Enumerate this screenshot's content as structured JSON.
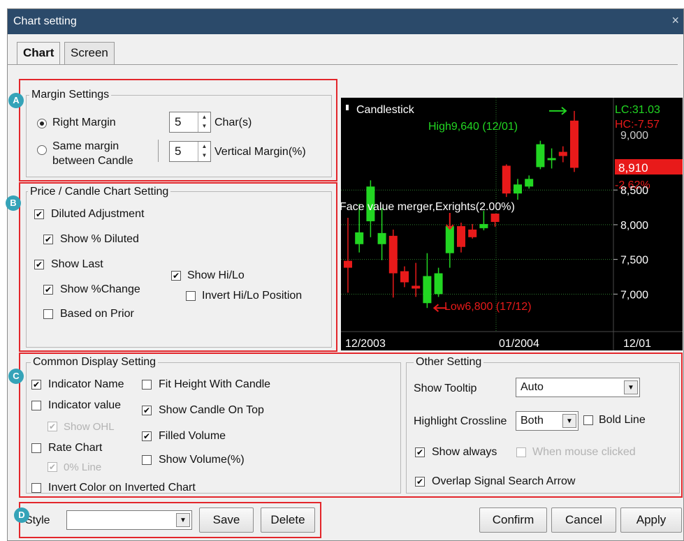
{
  "window": {
    "title": "Chart setting",
    "close_symbol": "×"
  },
  "tabs": [
    {
      "label": "Chart"
    },
    {
      "label": "Screen"
    }
  ],
  "badges": [
    "A",
    "B",
    "C",
    "D"
  ],
  "margin": {
    "title": "Margin Settings",
    "right_margin_label": "Right Margin",
    "right_margin_value": "5",
    "right_margin_unit": "Char(s)",
    "same_margin_label_1": "Same margin",
    "same_margin_label_2": "between Candle",
    "same_margin_value": "5",
    "vertical_margin_label": "Vertical Margin(%)",
    "selected": "right"
  },
  "price": {
    "title": "Price / Candle Chart Setting",
    "diluted_adjustment": "Diluted Adjustment",
    "show_pct_diluted": "Show % Diluted",
    "show_last": "Show Last",
    "show_pct_change": "Show %Change",
    "based_on_prior": "Based on Prior",
    "show_hilo": "Show Hi/Lo",
    "invert_hilo": "Invert Hi/Lo Position"
  },
  "common": {
    "title": "Common Display Setting",
    "indicator_name": "Indicator Name",
    "indicator_value": "Indicator value",
    "show_ohl": "Show OHL",
    "rate_chart": "Rate Chart",
    "zero_line": "0% Line",
    "invert_color": "Invert Color on Inverted Chart",
    "fit_height": "Fit Height With Candle",
    "show_candle_top": "Show Candle On Top",
    "filled_volume": "Filled Volume",
    "show_volume_pct": "Show Volume(%)"
  },
  "other": {
    "title": "Other Setting",
    "show_tooltip_label": "Show Tooltip",
    "show_tooltip_value": "Auto",
    "highlight_label": "Highlight Crossline",
    "highlight_value": "Both",
    "bold_line": "Bold Line",
    "show_always": "Show always",
    "when_clicked": "When mouse clicked",
    "overlap_signal": "Overlap Signal Search Arrow"
  },
  "footer": {
    "style_label": "Style",
    "style_value": "",
    "save": "Save",
    "delete": "Delete",
    "confirm": "Confirm",
    "cancel": "Cancel",
    "apply": "Apply"
  },
  "colors": {
    "up": "#22d622",
    "down": "#e81a1a",
    "highlight": "#e3262b",
    "title_bar": "#2b4a6a"
  },
  "chart_data": {
    "type": "candlestick",
    "title": "Candlestick",
    "lc_label": "LC:31.03",
    "hc_label": "HC:-7.57",
    "high_label": "High9,640 (12/01)",
    "low_label": "Low6,800 (17/12)",
    "annotation": "Face value merger,Exrights(2.00%)",
    "last_price": "8,910",
    "last_change": "-2.62%",
    "top_tick_partial": "9,000",
    "y_ticks": [
      "8,500",
      "8,000",
      "7,500",
      "7,000"
    ],
    "y_tick_values": [
      8500,
      8000,
      7500,
      7000
    ],
    "ylim": [
      6460,
      9830
    ],
    "x_labels": [
      "12/2003",
      "01/2004",
      "12/01"
    ],
    "candles": [
      {
        "o": 7480,
        "c": 7380,
        "h": 8100,
        "l": 7020
      },
      {
        "o": 7720,
        "c": 7890,
        "h": 8300,
        "l": 7600
      },
      {
        "o": 8050,
        "c": 8550,
        "h": 8640,
        "l": 7820
      },
      {
        "o": 7720,
        "c": 7880,
        "h": 8240,
        "l": 7490
      },
      {
        "o": 7840,
        "c": 7300,
        "h": 7930,
        "l": 6950
      },
      {
        "o": 7330,
        "c": 7170,
        "h": 7400,
        "l": 7100
      },
      {
        "o": 7120,
        "c": 7080,
        "h": 7450,
        "l": 6960
      },
      {
        "o": 6870,
        "c": 7260,
        "h": 7590,
        "l": 6800
      },
      {
        "o": 7000,
        "c": 7300,
        "h": 7380,
        "l": 6960
      },
      {
        "o": 7590,
        "c": 7980,
        "h": 8010,
        "l": 7380
      },
      {
        "o": 7980,
        "c": 7680,
        "h": 8030,
        "l": 7600
      },
      {
        "o": 7930,
        "c": 7820,
        "h": 8010,
        "l": 7800
      },
      {
        "o": 7950,
        "c": 8010,
        "h": 8200,
        "l": 7920
      },
      {
        "o": 8160,
        "c": 8040,
        "h": 8120,
        "l": 7970
      },
      {
        "o": 8850,
        "c": 8450,
        "h": 8870,
        "l": 8400
      },
      {
        "o": 8450,
        "c": 8580,
        "h": 8660,
        "l": 8360
      },
      {
        "o": 8550,
        "c": 8660,
        "h": 8710,
        "l": 8520
      },
      {
        "o": 8830,
        "c": 9160,
        "h": 9210,
        "l": 8800
      },
      {
        "o": 8930,
        "c": 8960,
        "h": 9100,
        "l": 8810
      },
      {
        "o": 9050,
        "c": 8990,
        "h": 9130,
        "l": 8900
      },
      {
        "o": 9500,
        "c": 8820,
        "h": 9640,
        "l": 8760
      }
    ]
  }
}
